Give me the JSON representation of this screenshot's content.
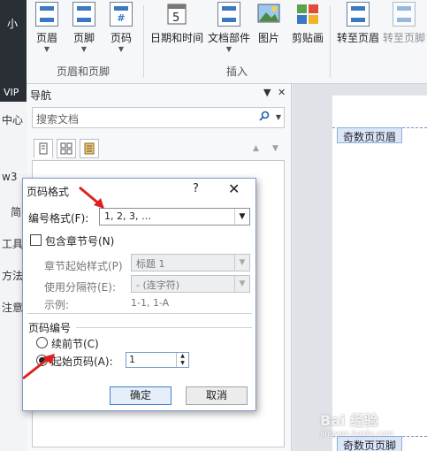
{
  "ribbon": {
    "left_text": "小",
    "buttons": [
      {
        "label": "页眉",
        "icon": "header-icon"
      },
      {
        "label": "页脚",
        "icon": "footer-icon"
      },
      {
        "label": "页码",
        "icon": "page-number-icon"
      },
      {
        "label": "日期和时间",
        "icon": "calendar-icon"
      },
      {
        "label": "文档部件",
        "icon": "document-parts-icon"
      },
      {
        "label": "图片",
        "icon": "picture-icon"
      },
      {
        "label": "剪贴画",
        "icon": "clipart-icon"
      },
      {
        "label": "转至页眉",
        "icon": "goto-header-icon"
      },
      {
        "label": "转至页脚",
        "icon": "goto-footer-icon"
      }
    ],
    "groups": [
      "页眉和页脚",
      "插入"
    ]
  },
  "left_strip": [
    "VIP",
    "中心",
    "w3",
    "简",
    "工具",
    "方法",
    "注意"
  ],
  "nav": {
    "title": "导航",
    "search_placeholder": "搜索文档"
  },
  "document": {
    "header_tag": "奇数页页眉",
    "footer_tag": "奇数页页脚"
  },
  "dialog": {
    "title": "页码格式",
    "help": "?",
    "close": "✕",
    "format_label": "编号格式(F):",
    "format_value": "1, 2, 3, …",
    "include_chapter_label": "包含章节号(N)",
    "chapter_start_label": "章节起始样式(P)",
    "chapter_start_value": "标题 1",
    "separator_label": "使用分隔符(E):",
    "separator_value": "-  (连字符)",
    "example_label": "示例:",
    "example_value": "1-1, 1-A",
    "page_numbering_label": "页码编号",
    "continue_label": "续前节(C)",
    "start_at_label": "起始页码(A):",
    "start_at_value": "1",
    "ok": "确定",
    "cancel": "取消"
  },
  "watermark": {
    "text": "Bai 经验",
    "sub": "jingyan.baidu.com"
  },
  "colors": {
    "accent": "#3c7fd1",
    "arrow": "#e02020"
  }
}
